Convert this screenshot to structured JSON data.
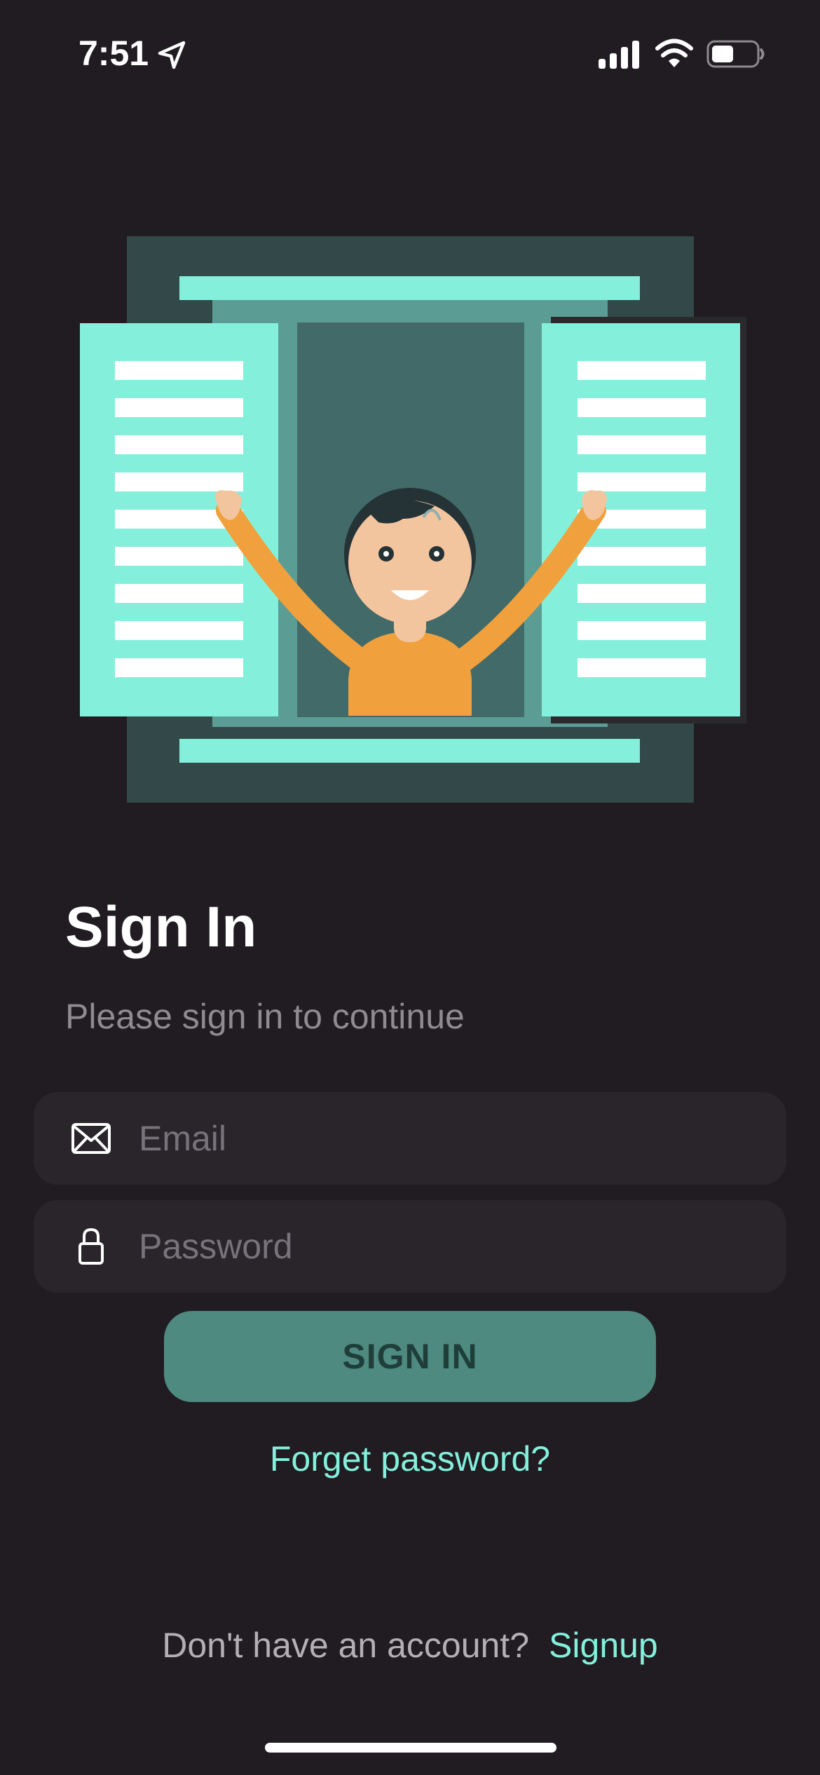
{
  "status_bar": {
    "time": "7:51"
  },
  "illustration": {
    "icon": "person-waving-from-window-illustration"
  },
  "header": {
    "title": "Sign In",
    "subtitle": "Please sign in to continue"
  },
  "form": {
    "email": {
      "placeholder": "Email",
      "value": "",
      "icon": "envelope-icon"
    },
    "password": {
      "placeholder": "Password",
      "value": "",
      "icon": "lock-icon"
    },
    "submit_label": "SIGN IN",
    "forgot_label": "Forget password?"
  },
  "footer": {
    "question": "Don't have an account?",
    "signup_label": "Signup"
  },
  "colors": {
    "background": "#201c21",
    "accent": "#84f0dc",
    "button": "#4e8a80",
    "field": "#29252a"
  }
}
